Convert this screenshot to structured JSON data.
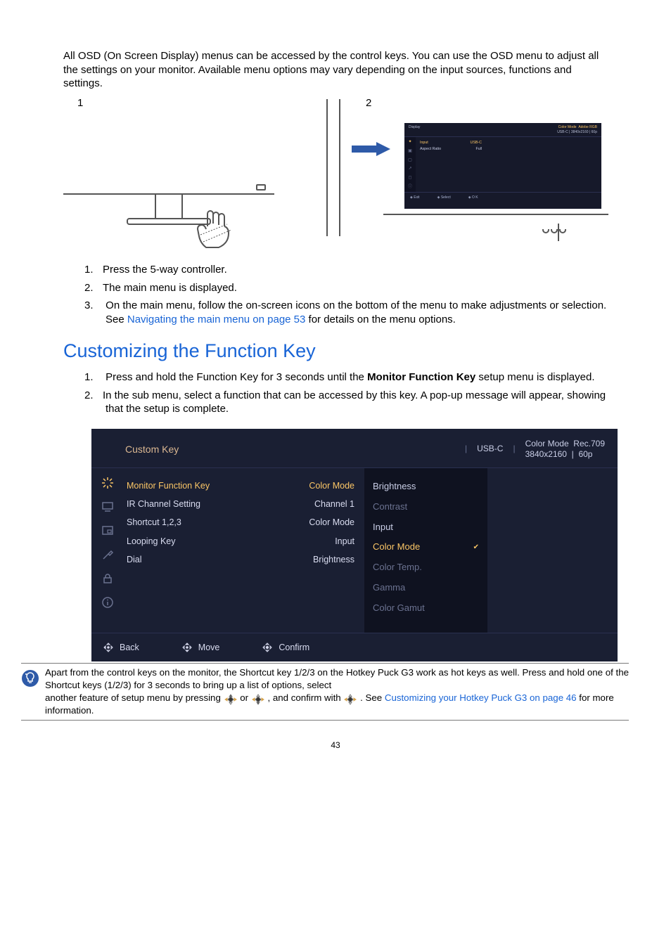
{
  "intro": "All OSD (On Screen Display) menus can be accessed by the control keys. You can use the OSD menu to adjust all the settings on your monitor. Available menu options may vary depending on the input sources, functions and settings.",
  "figure": {
    "label1": "1",
    "label2": "2"
  },
  "mini_osd": {
    "title": "Display",
    "cm_label": "Color Mode",
    "cm_value": "Adobe RGB",
    "status": "USB-C  |  3840x2160  | 60p",
    "rows": [
      {
        "label": "Input",
        "value": "USB-C"
      },
      {
        "label": "Aspect Ratio",
        "value": "Full"
      }
    ],
    "hints": {
      "exit": "Exit",
      "select": "Select",
      "ok": "O K"
    }
  },
  "steps": {
    "s1": "Press the 5-way controller.",
    "s2": "The main menu is displayed.",
    "s3_a": "On the main menu, follow the on-screen icons on the bottom of the menu to make adjustments or selection. See ",
    "s3_link": "Navigating the main menu on page 53",
    "s3_b": " for details on the menu options."
  },
  "section_title": "Customizing the Function Key",
  "steps2": {
    "s1_a": "Press and hold the Function Key for 3 seconds until the ",
    "s1_bold": "Monitor Function Key",
    "s1_b": " setup menu is displayed.",
    "s2": "In the sub menu, select a function that can be accessed by this key. A pop-up message will appear, showing that the setup is complete."
  },
  "osd": {
    "title": "Custom Key",
    "status_input": "USB-C",
    "cm_label": "Color Mode",
    "cm_value": "Rec.709",
    "res": "3840x2160",
    "hz": "60p",
    "col1": [
      "Monitor Function Key",
      "IR Channel Setting",
      "Shortcut 1,2,3",
      "Looping Key",
      "Dial"
    ],
    "col2": [
      "Color Mode",
      "Channel 1",
      "Color Mode",
      "Input",
      "Brightness"
    ],
    "col3": [
      "Brightness",
      "Contrast",
      "Input",
      "Color Mode",
      "Color Temp.",
      "Gamma",
      "Color Gamut"
    ],
    "col3_selected_index": 3,
    "footer": {
      "back": "Back",
      "move": "Move",
      "confirm": "Confirm"
    }
  },
  "tip": {
    "line1": "Apart from the control keys on the monitor, the Shortcut key 1/2/3 on the Hotkey Puck G3 work as hot keys as well. Press and hold one of the Shortcut keys (1/2/3) for 3 seconds to bring up a list of options, select",
    "line2a": "another feature of setup menu by pressing ",
    "line2b": " or ",
    "line2c": ", and confirm with ",
    "line2d": ". See ",
    "link": "Customizing your Hotkey Puck G3 on page 46",
    "line2e": " for more information."
  },
  "page_number": "43"
}
